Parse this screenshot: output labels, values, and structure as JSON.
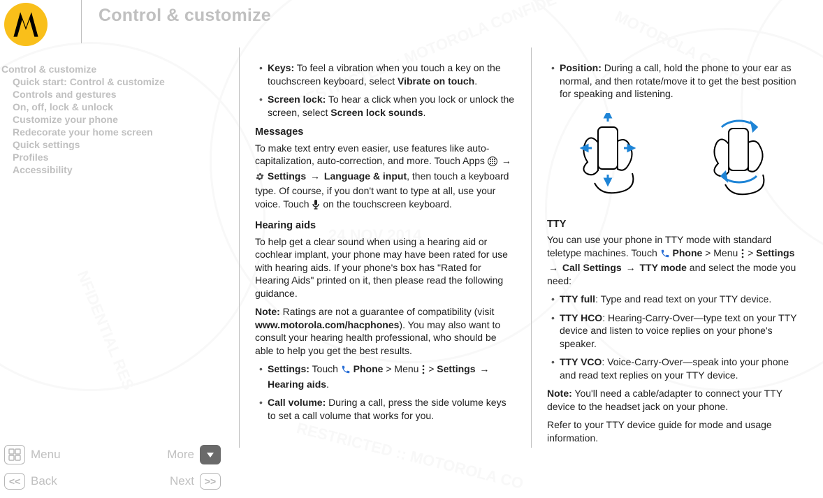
{
  "header": {
    "title": "Control & customize"
  },
  "sidebar": {
    "items": [
      "Control & customize",
      "Quick start: Control & customize",
      "Controls and gestures",
      "On, off, lock & unlock",
      "Customize your phone",
      "Redecorate your home screen",
      "Quick settings",
      "Profiles",
      "Accessibility"
    ]
  },
  "col1": {
    "bullet_keys_lead": "Keys:",
    "bullet_keys_text": " To feel a vibration when you touch a key on the touchscreen keyboard, select ",
    "bullet_keys_opt": "Vibrate on touch",
    "bullet_screenlock_lead": "Screen lock:",
    "bullet_screenlock_text": " To hear a click when you lock or unlock the screen, select ",
    "bullet_screenlock_opt": "Screen lock sounds",
    "messages_heading": "Messages",
    "messages_p1a": "To make text entry even easier, use features like auto-capitalization, auto-correction, and more. Touch Apps ",
    "messages_p1b": " > ",
    "messages_settings": "Settings",
    "messages_langinput": "Language & input",
    "messages_p1c": ", then touch a keyboard type. Of course, if you don't want to type at all, use your voice. Touch ",
    "messages_p1d": " on the touchscreen keyboard.",
    "hearing_heading": "Hearing aids",
    "hearing_p1": "To help get a clear sound when using a hearing aid or cochlear implant, your phone may have been rated for use with hearing aids. If your phone's box has \"Rated for Hearing Aids\" printed on it, then please read the following guidance.",
    "note_label": "Note:",
    "hearing_note_text": " Ratings are not a guarantee of compatibility (visit ",
    "hearing_url": "www.motorola.com/hacphones",
    "hearing_note_text2": "). You may also want to consult your hearing health professional, who should be able to help you get the best results.",
    "bullet_settings_lead": "Settings:",
    "bullet_settings_text_a": " Touch ",
    "bullet_settings_phone": "Phone",
    "bullet_settings_text_b": " > Menu ",
    "bullet_settings_text_c": " > ",
    "bullet_set_settings": "Settings",
    "bullet_set_hearing": "Hearing aids",
    "bullet_callvol_lead": "Call volume:",
    "bullet_callvol_text": " During a call, press the side volume keys to set a call volume that works for you."
  },
  "col2": {
    "bullet_pos_lead": "Position:",
    "bullet_pos_text": " During a call, hold the phone to your ear as normal, and then rotate/move it to get the best position for speaking and listening.",
    "tty_heading": "TTY",
    "tty_p1a": "You can use your phone in TTY mode with standard teletype machines. Touch ",
    "tty_phone": "Phone",
    "tty_p1b": " > Menu ",
    "tty_p1c": " > ",
    "tty_settings": "Settings",
    "tty_call_settings": "Call Settings",
    "tty_mode": "TTY mode",
    "tty_p1d": " and select the mode you need:",
    "bullet_ttyfull_lead": "TTY full",
    "bullet_ttyfull_text": ": Type and read text on your TTY device.",
    "bullet_ttyhco_lead": "TTY HCO",
    "bullet_ttyhco_text": ": Hearing-Carry-Over—type text on your TTY device and listen to voice replies on your phone's speaker.",
    "bullet_ttyvco_lead": "TTY VCO",
    "bullet_ttyvco_text": ": Voice-Carry-Over—speak into your phone and read text replies on your TTY device.",
    "tty_note": " You'll need a cable/adapter to connect your TTY device to the headset jack on your phone.",
    "tty_p2": "Refer to your TTY device guide for mode and usage information."
  },
  "footer": {
    "menu": "Menu",
    "more": "More",
    "back": "Back",
    "next": "Next"
  },
  "watermark": {
    "date": "24 NOV 2014"
  }
}
